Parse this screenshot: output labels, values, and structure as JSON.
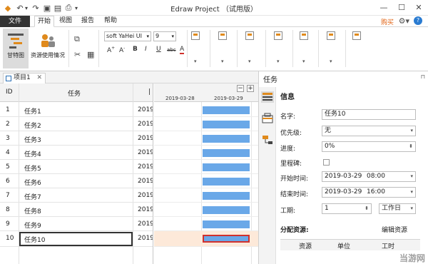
{
  "window": {
    "title": "Edraw Project （试用版）",
    "min": "—",
    "max": "☐",
    "close": "✕"
  },
  "quick_access": {
    "undo": "↶",
    "undo_dropdown": "▾",
    "redo": "↷",
    "save": "▣",
    "export": "▤",
    "print": "⎙",
    "print_dropdown": "▾"
  },
  "menu": {
    "file": "文件",
    "tabs": [
      "开始",
      "视图",
      "报告",
      "帮助"
    ],
    "active_tab": "开始",
    "buy": "购买",
    "settings": "⚙▾",
    "help": "?"
  },
  "ribbon": {
    "gantt_view": "甘特图",
    "resource_usage": "资源使用情况",
    "font_name": "soft YaHei UI",
    "font_size": "9",
    "dropdown_arrow": "▾",
    "copy_icon": "⧉",
    "cut_icon": "✂",
    "paste_icon": "▦",
    "grow_font": "A",
    "grow_font_mark": "+",
    "shrink_font": "A",
    "shrink_font_mark": "-",
    "bold": "B",
    "italic": "I",
    "underline": "U",
    "strike": "abc",
    "font_color": "A",
    "group_arrows": [
      "▾",
      "▾",
      "▾",
      "▾",
      "▾",
      "▾"
    ]
  },
  "document_tab": {
    "label": "项目1",
    "close": "✕"
  },
  "grid": {
    "col_id": "ID",
    "col_task": "任务",
    "col_start": "2019",
    "rows": [
      {
        "id": "1",
        "name": "任务1",
        "start": "2019"
      },
      {
        "id": "2",
        "name": "任务2",
        "start": "2019"
      },
      {
        "id": "3",
        "name": "任务3",
        "start": "2019"
      },
      {
        "id": "4",
        "name": "任务4",
        "start": "2019"
      },
      {
        "id": "5",
        "name": "任务5",
        "start": "2019"
      },
      {
        "id": "6",
        "name": "任务6",
        "start": "2019"
      },
      {
        "id": "7",
        "name": "任务7",
        "start": "2019"
      },
      {
        "id": "8",
        "name": "任务8",
        "start": "2019"
      },
      {
        "id": "9",
        "name": "任务9",
        "start": "2019"
      },
      {
        "id": "10",
        "name": "任务10",
        "start": "2019"
      }
    ],
    "selected_row": "10"
  },
  "gantt": {
    "dates": [
      "2019-03-28",
      "2019-03-29"
    ],
    "zoom_out": "−",
    "zoom_in": "+"
  },
  "panel": {
    "title": "任务",
    "pin": "⊓",
    "section": "信息",
    "name_label": "名字:",
    "name_value": "任务10",
    "priority_label": "优先级:",
    "priority_value": "无",
    "progress_label": "进度:",
    "progress_value": "0%",
    "milestone_label": "里程碑:",
    "start_label": "开始时间:",
    "start_date": "2019-03-29",
    "start_time": "08:00",
    "end_label": "结束时间:",
    "end_date": "2019-03-29",
    "end_time": "16:00",
    "duration_label": "工期:",
    "duration_value": "1",
    "duration_unit": "工作日",
    "dropdown_arrow": "▾",
    "spin_arrow": "⬍",
    "resources_title": "分配资源:",
    "edit_resources": "编辑资源",
    "res_col_resource": "资源",
    "res_col_unit": "单位",
    "res_col_hours": "工时"
  },
  "colors": {
    "gantt_bar": "#6aa8e8",
    "accent_orange": "#e06010",
    "file_tab": "#333333",
    "selection_highlight": "#fde9d9",
    "selected_bar_border": "#d0312d"
  },
  "watermark": "当游网"
}
